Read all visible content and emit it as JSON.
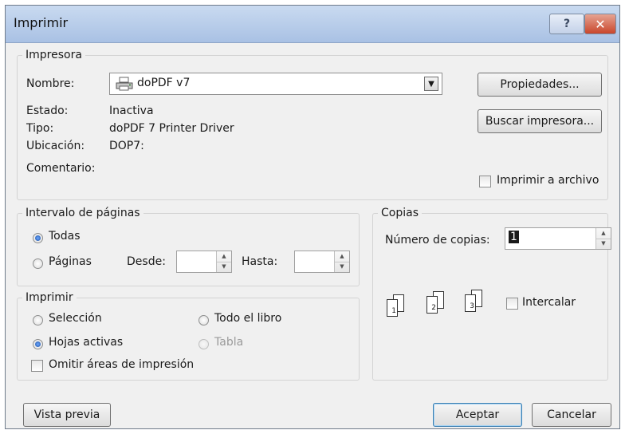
{
  "titlebar": {
    "title": "Imprimir",
    "help_label": "?",
    "close_label": "✕"
  },
  "printer": {
    "group_label": "Impresora",
    "name_label": "Nombre:",
    "name_value": "doPDF v7",
    "status_label": "Estado:",
    "status_value": "Inactiva",
    "type_label": "Tipo:",
    "type_value": "doPDF 7 Printer Driver",
    "location_label": "Ubicación:",
    "location_value": "DOP7:",
    "comment_label": "Comentario:",
    "properties_button": "Propiedades...",
    "find_printer_button": "Buscar impresora...",
    "print_to_file_label": "Imprimir a archivo",
    "print_to_file_checked": false
  },
  "page_range": {
    "group_label": "Intervalo de páginas",
    "all_label": "Todas",
    "pages_label": "Páginas",
    "from_label": "Desde:",
    "from_value": "",
    "to_label": "Hasta:",
    "to_value": "",
    "selected": "Todas"
  },
  "print_what": {
    "group_label": "Imprimir",
    "selection_label": "Selección",
    "entire_workbook_label": "Todo el libro",
    "active_sheets_label": "Hojas activas",
    "table_label": "Tabla",
    "ignore_print_areas_label": "Omitir áreas de impresión",
    "selected": "Hojas activas"
  },
  "copies": {
    "group_label": "Copias",
    "number_label": "Número de copias:",
    "number_value": "1",
    "collate_label": "Intercalar",
    "collate_checked": false,
    "collate_icon_pages": [
      "1",
      "2",
      "3"
    ]
  },
  "footer": {
    "preview_button": "Vista previa",
    "ok_button": "Aceptar",
    "cancel_button": "Cancelar"
  },
  "icons": {
    "help": "help-icon",
    "close": "close-icon",
    "printer": "printer-icon",
    "dropdown": "chevron-down-icon",
    "spinner": "spinner-arrows-icon",
    "collate": "collate-pages-icon"
  }
}
